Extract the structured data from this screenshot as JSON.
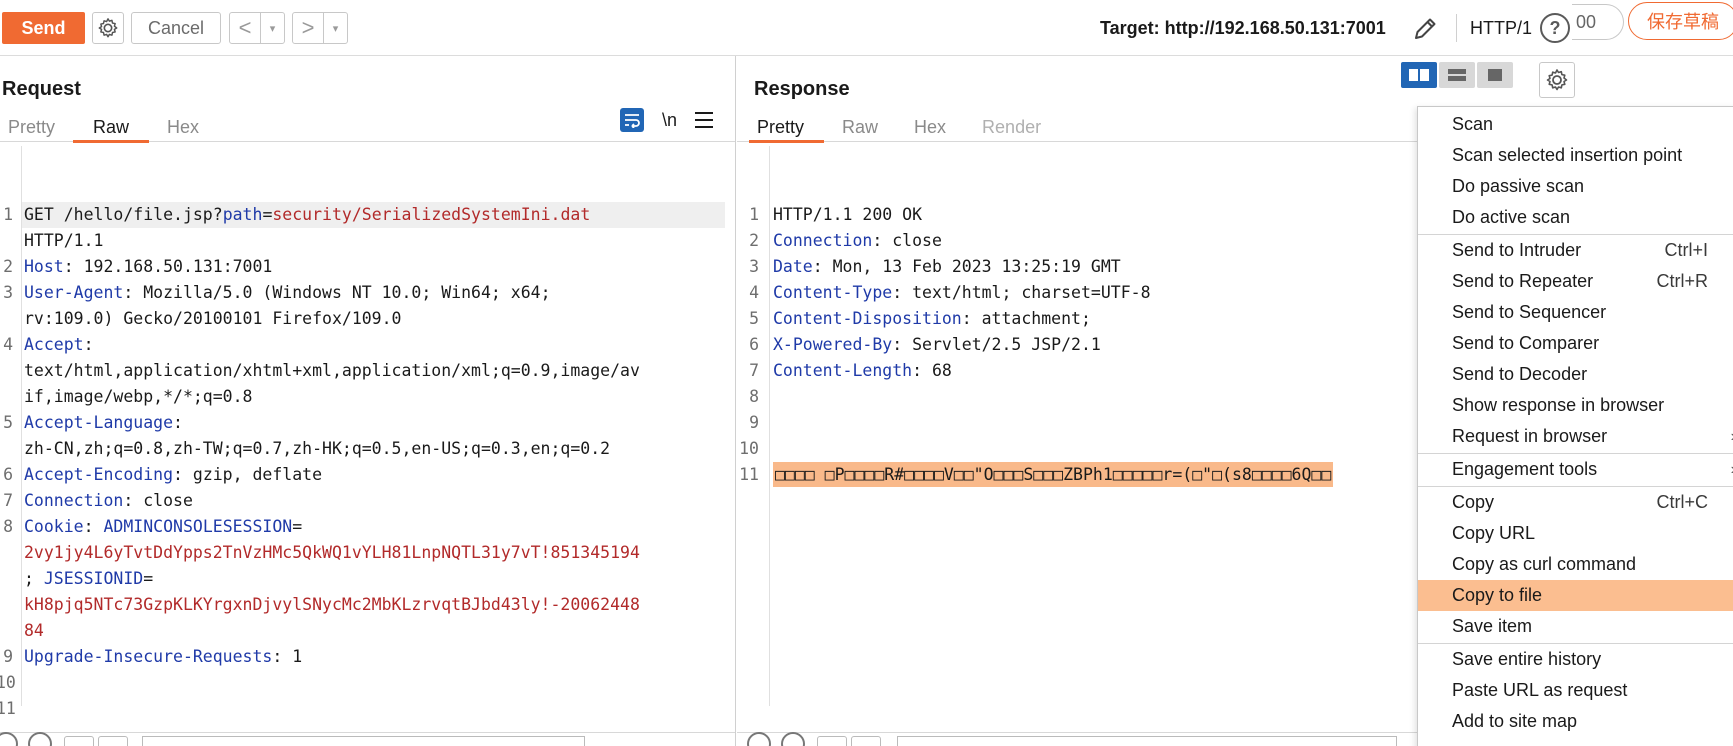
{
  "toolbar": {
    "send_label": "Send",
    "cancel_label": "Cancel",
    "back_label": "<",
    "forward_label": ">",
    "dropdown_glyph": "▾",
    "target_text": "Target: http://192.168.50.131:7001",
    "protocol": "HTTP/1",
    "help_glyph": "?",
    "partial_text": "00",
    "draft_label": "保存草稿"
  },
  "request": {
    "title": "Request",
    "tabs": [
      "Pretty",
      "Raw",
      "Hex"
    ],
    "active_tab": "Raw",
    "newline_toggle": "\\n",
    "lines": [
      {
        "n": "1",
        "rows": [
          [
            {
              "t": "GET /hello/file.jsp?",
              "c": ""
            },
            {
              "t": "path",
              "c": "k"
            },
            {
              "t": "=",
              "c": ""
            },
            {
              "t": "security/SerializedSystemIni.dat",
              "c": "v"
            }
          ],
          [
            {
              "t": "HTTP/1.1",
              "c": ""
            }
          ]
        ]
      },
      {
        "n": "2",
        "rows": [
          [
            {
              "t": "Host",
              "c": "k"
            },
            {
              "t": ": 192.168.50.131:7001",
              "c": ""
            }
          ]
        ]
      },
      {
        "n": "3",
        "rows": [
          [
            {
              "t": "User-Agent",
              "c": "k"
            },
            {
              "t": ": Mozilla/5.0 (Windows NT 10.0; Win64; x64;",
              "c": ""
            }
          ],
          [
            {
              "t": "rv:109.0) Gecko/20100101 Firefox/109.0",
              "c": ""
            }
          ]
        ]
      },
      {
        "n": "4",
        "rows": [
          [
            {
              "t": "Accept",
              "c": "k"
            },
            {
              "t": ":",
              "c": ""
            }
          ],
          [
            {
              "t": "text/html,application/xhtml+xml,application/xml;q=0.9,image/av",
              "c": ""
            }
          ],
          [
            {
              "t": "if,image/webp,*/*;q=0.8",
              "c": ""
            }
          ]
        ]
      },
      {
        "n": "5",
        "rows": [
          [
            {
              "t": "Accept-Language",
              "c": "k"
            },
            {
              "t": ":",
              "c": ""
            }
          ],
          [
            {
              "t": "zh-CN,zh;q=0.8,zh-TW;q=0.7,zh-HK;q=0.5,en-US;q=0.3,en;q=0.2",
              "c": ""
            }
          ]
        ]
      },
      {
        "n": "6",
        "rows": [
          [
            {
              "t": "Accept-Encoding",
              "c": "k"
            },
            {
              "t": ": gzip, deflate",
              "c": ""
            }
          ]
        ]
      },
      {
        "n": "7",
        "rows": [
          [
            {
              "t": "Connection",
              "c": "k"
            },
            {
              "t": ": close",
              "c": ""
            }
          ]
        ]
      },
      {
        "n": "8",
        "rows": [
          [
            {
              "t": "Cookie",
              "c": "k"
            },
            {
              "t": ": ",
              "c": ""
            },
            {
              "t": "ADMINCONSOLESESSION",
              "c": "k"
            },
            {
              "t": "=",
              "c": ""
            }
          ],
          [
            {
              "t": "2vy1jy4L6yTvtDdYpps2TnVzHMc5QkWQ1vYLH81LnpNQTL31y7vT!851345194",
              "c": "v"
            }
          ],
          [
            {
              "t": "; ",
              "c": ""
            },
            {
              "t": "JSESSIONID",
              "c": "k"
            },
            {
              "t": "=",
              "c": ""
            }
          ],
          [
            {
              "t": "kH8pjq5NTc73GzpKLKYrgxnDjvylSNycMc2MbKLzrvqtBJbd43ly!-20062448",
              "c": "v"
            }
          ],
          [
            {
              "t": "84",
              "c": "v"
            }
          ]
        ]
      },
      {
        "n": "9",
        "rows": [
          [
            {
              "t": "Upgrade-Insecure-Requests",
              "c": "k"
            },
            {
              "t": ": 1",
              "c": ""
            }
          ]
        ]
      },
      {
        "n": "10",
        "rows": [
          [
            {
              "t": "",
              "c": ""
            }
          ]
        ]
      },
      {
        "n": "11",
        "rows": [
          [
            {
              "t": "",
              "c": ""
            }
          ]
        ]
      }
    ]
  },
  "response": {
    "title": "Response",
    "tabs": [
      "Pretty",
      "Raw",
      "Hex",
      "Render"
    ],
    "active_tab": "Pretty",
    "lines": [
      {
        "n": "1",
        "rows": [
          [
            {
              "t": "HTTP/1.1 200 OK",
              "c": ""
            }
          ]
        ]
      },
      {
        "n": "2",
        "rows": [
          [
            {
              "t": "Connection",
              "c": "k"
            },
            {
              "t": ": close",
              "c": ""
            }
          ]
        ]
      },
      {
        "n": "3",
        "rows": [
          [
            {
              "t": "Date",
              "c": "k"
            },
            {
              "t": ": Mon, 13 Feb 2023 13:25:19 GMT",
              "c": ""
            }
          ]
        ]
      },
      {
        "n": "4",
        "rows": [
          [
            {
              "t": "Content-Type",
              "c": "k"
            },
            {
              "t": ": text/html; charset=UTF-8",
              "c": ""
            }
          ]
        ]
      },
      {
        "n": "5",
        "rows": [
          [
            {
              "t": "Content-Disposition",
              "c": "k"
            },
            {
              "t": ": attachment;",
              "c": ""
            }
          ]
        ]
      },
      {
        "n": "6",
        "rows": [
          [
            {
              "t": "X-Powered-By",
              "c": "k"
            },
            {
              "t": ": Servlet/2.5 JSP/2.1",
              "c": ""
            }
          ]
        ]
      },
      {
        "n": "7",
        "rows": [
          [
            {
              "t": "Content-Length",
              "c": "k"
            },
            {
              "t": ": 68",
              "c": ""
            }
          ]
        ]
      },
      {
        "n": "8",
        "rows": [
          [
            {
              "t": "",
              "c": ""
            }
          ]
        ]
      },
      {
        "n": "9",
        "rows": [
          [
            {
              "t": "",
              "c": ""
            }
          ]
        ]
      },
      {
        "n": "10",
        "rows": [
          [
            {
              "t": "",
              "c": ""
            }
          ]
        ]
      },
      {
        "n": "11",
        "rows": [
          [
            {
              "t": "□□□□ □P□□□□R#□□□□V□□\"O□□□S□□□ZBPh1□□□□□r=(□\"□(s8□□□□6Q□□",
              "c": "bin"
            }
          ]
        ]
      }
    ]
  },
  "context_menu": {
    "groups": [
      [
        {
          "label": "Scan"
        },
        {
          "label": "Scan selected insertion point"
        },
        {
          "label": "Do passive scan"
        },
        {
          "label": "Do active scan"
        }
      ],
      [
        {
          "label": "Send to Intruder",
          "shortcut": "Ctrl+I"
        },
        {
          "label": "Send to Repeater",
          "shortcut": "Ctrl+R"
        },
        {
          "label": "Send to Sequencer"
        },
        {
          "label": "Send to Comparer"
        },
        {
          "label": "Send to Decoder"
        },
        {
          "label": "Show response in browser"
        },
        {
          "label": "Request in browser",
          "submenu": true
        }
      ],
      [
        {
          "label": "Engagement tools",
          "submenu": true
        }
      ],
      [
        {
          "label": "Copy",
          "shortcut": "Ctrl+C"
        },
        {
          "label": "Copy URL"
        },
        {
          "label": "Copy as curl command"
        },
        {
          "label": "Copy to file",
          "highlighted": true
        },
        {
          "label": "Save item"
        }
      ],
      [
        {
          "label": "Save entire history"
        },
        {
          "label": "Paste URL as request"
        },
        {
          "label": "Add to site map"
        }
      ]
    ]
  },
  "colors": {
    "accent": "#f06a32",
    "key": "#1f3aa8",
    "value": "#b22a2a",
    "menu_highlight": "#fbbe90",
    "binary_highlight": "#f9b98a",
    "toggle_active": "#2166b5"
  }
}
